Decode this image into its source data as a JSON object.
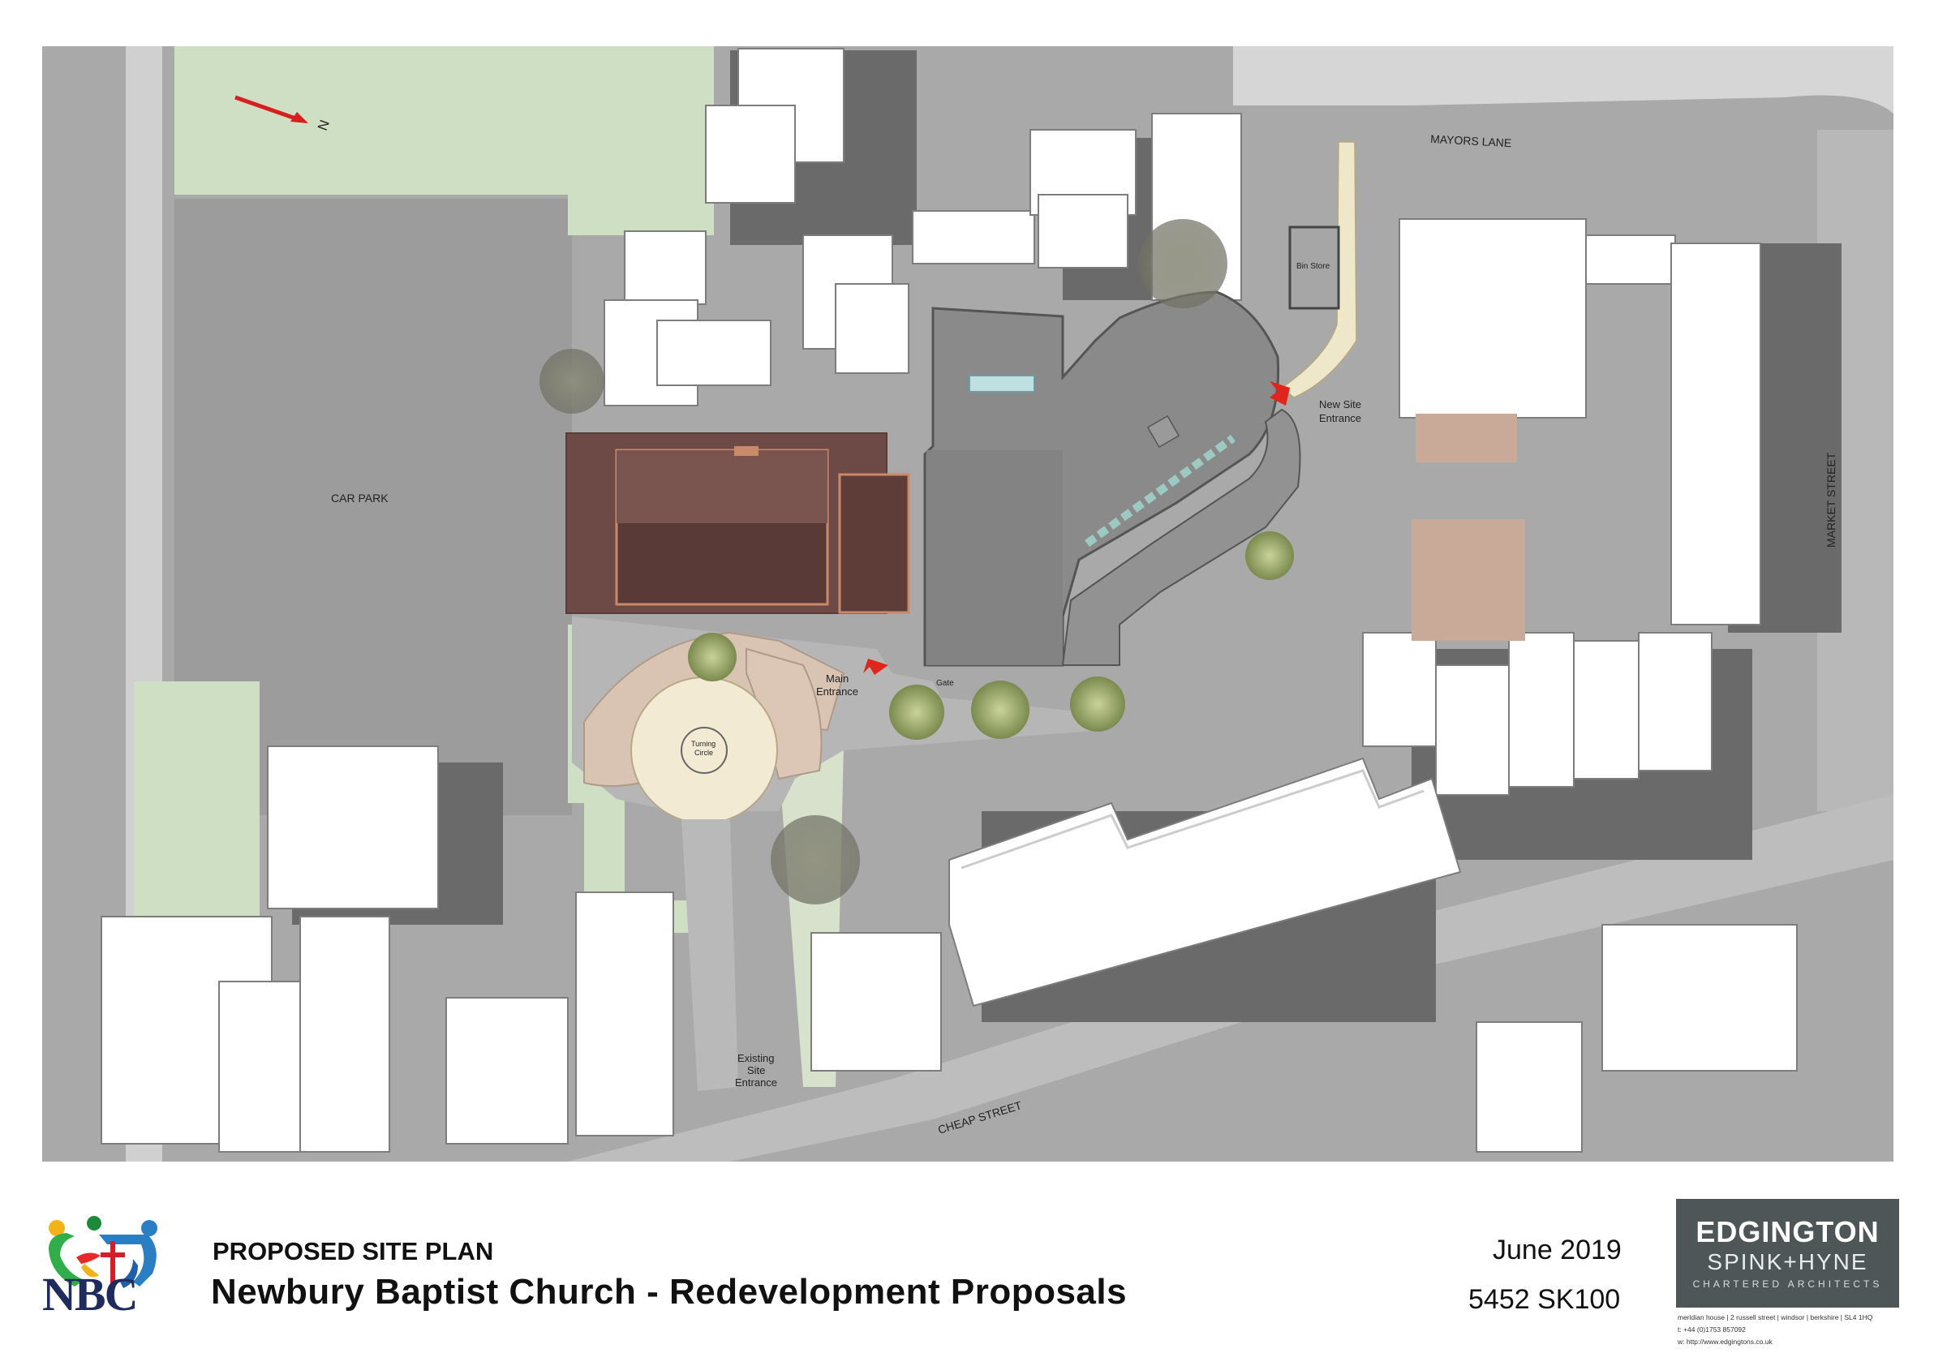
{
  "map": {
    "north_label": "N",
    "labels": {
      "mayors_lane": "MAYORS LANE",
      "market_street": "MARKET STREET",
      "cheap_street": "CHEAP STREET",
      "car_park": "CAR PARK",
      "bin_store": "Bin Store",
      "new_site_entrance_1": "New Site",
      "new_site_entrance_2": "Entrance",
      "main_entrance_1": "Main",
      "main_entrance_2": "Entrance",
      "gate": "Gate",
      "turning_circle_1": "Turning",
      "turning_circle_2": "Circle",
      "existing_site_entrance_1": "Existing",
      "existing_site_entrance_2": "Site",
      "existing_site_entrance_3": "Entrance"
    },
    "colors": {
      "background": "#a9a9a9",
      "ground": "#9b9b9b",
      "pavement": "#d2d2d2",
      "grass": "#cfdfc4",
      "building_roof": "#ffffff",
      "building_shadow": "#6a6a6a",
      "new_building": "#8a8a8a",
      "church_roof": "#6d4a45",
      "paving_pink": "#d9c3b2",
      "turning_circle": "#f2ead2",
      "tree": "#9aa37a",
      "entrance_arrow": "#e0261c"
    }
  },
  "title_block": {
    "subtitle": "PROPOSED SITE PLAN",
    "title": "Newbury Baptist Church - Redevelopment Proposals",
    "date": "June 2019",
    "drawing_ref": "5452 SK100"
  },
  "client_logo": {
    "text": "NBC",
    "icon": "cross-people-icon"
  },
  "architect": {
    "name": "EDGINGTON",
    "partners": "SPINK+HYNE",
    "tagline": "CHARTERED ARCHITECTS",
    "address": "meridian house | 2 russell street | windsor | berkshire | SL4 1HQ",
    "phone": "t:  +44 (0)1753 857092",
    "web": "w: http://www.edgingtons.co.uk"
  }
}
